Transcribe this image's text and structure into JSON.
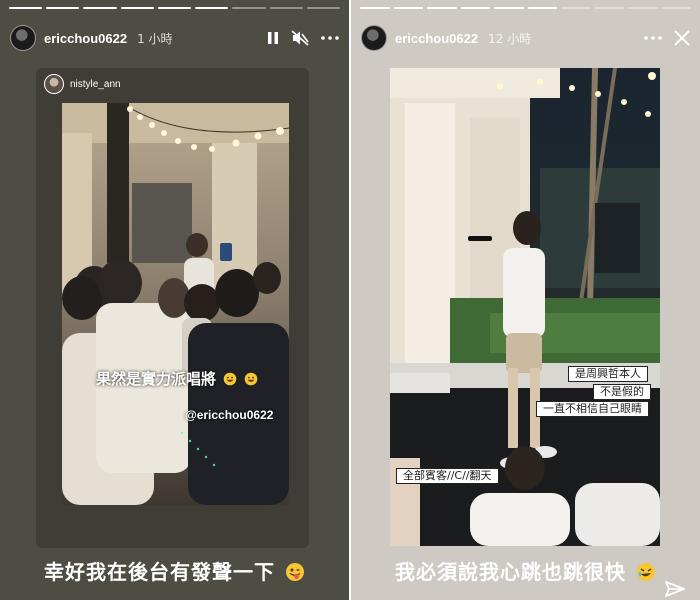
{
  "left_story": {
    "username": "ericchou0622",
    "time": "1 小時",
    "shared_username": "nistyle_ann",
    "sticker_text": "果然是實力派唱將",
    "mention": "@ericchou0622",
    "caption": "幸好我在後台有發聲一下",
    "icons": [
      "pause-icon",
      "mute-icon",
      "more-icon"
    ]
  },
  "right_story": {
    "username": "ericchou0622",
    "time": "12 小時",
    "labels": [
      "是周興哲本人",
      "不是假的",
      "一直不相信自己眼睛",
      "全部賓客//C//翻天"
    ],
    "caption": "我必須說我心跳也跳很快",
    "icons": [
      "more-icon",
      "close-icon",
      "send-icon"
    ]
  },
  "colors": {
    "left_bg": "#4e4d44",
    "right_bg": "#cfc9c3",
    "text": "#ffffff"
  }
}
